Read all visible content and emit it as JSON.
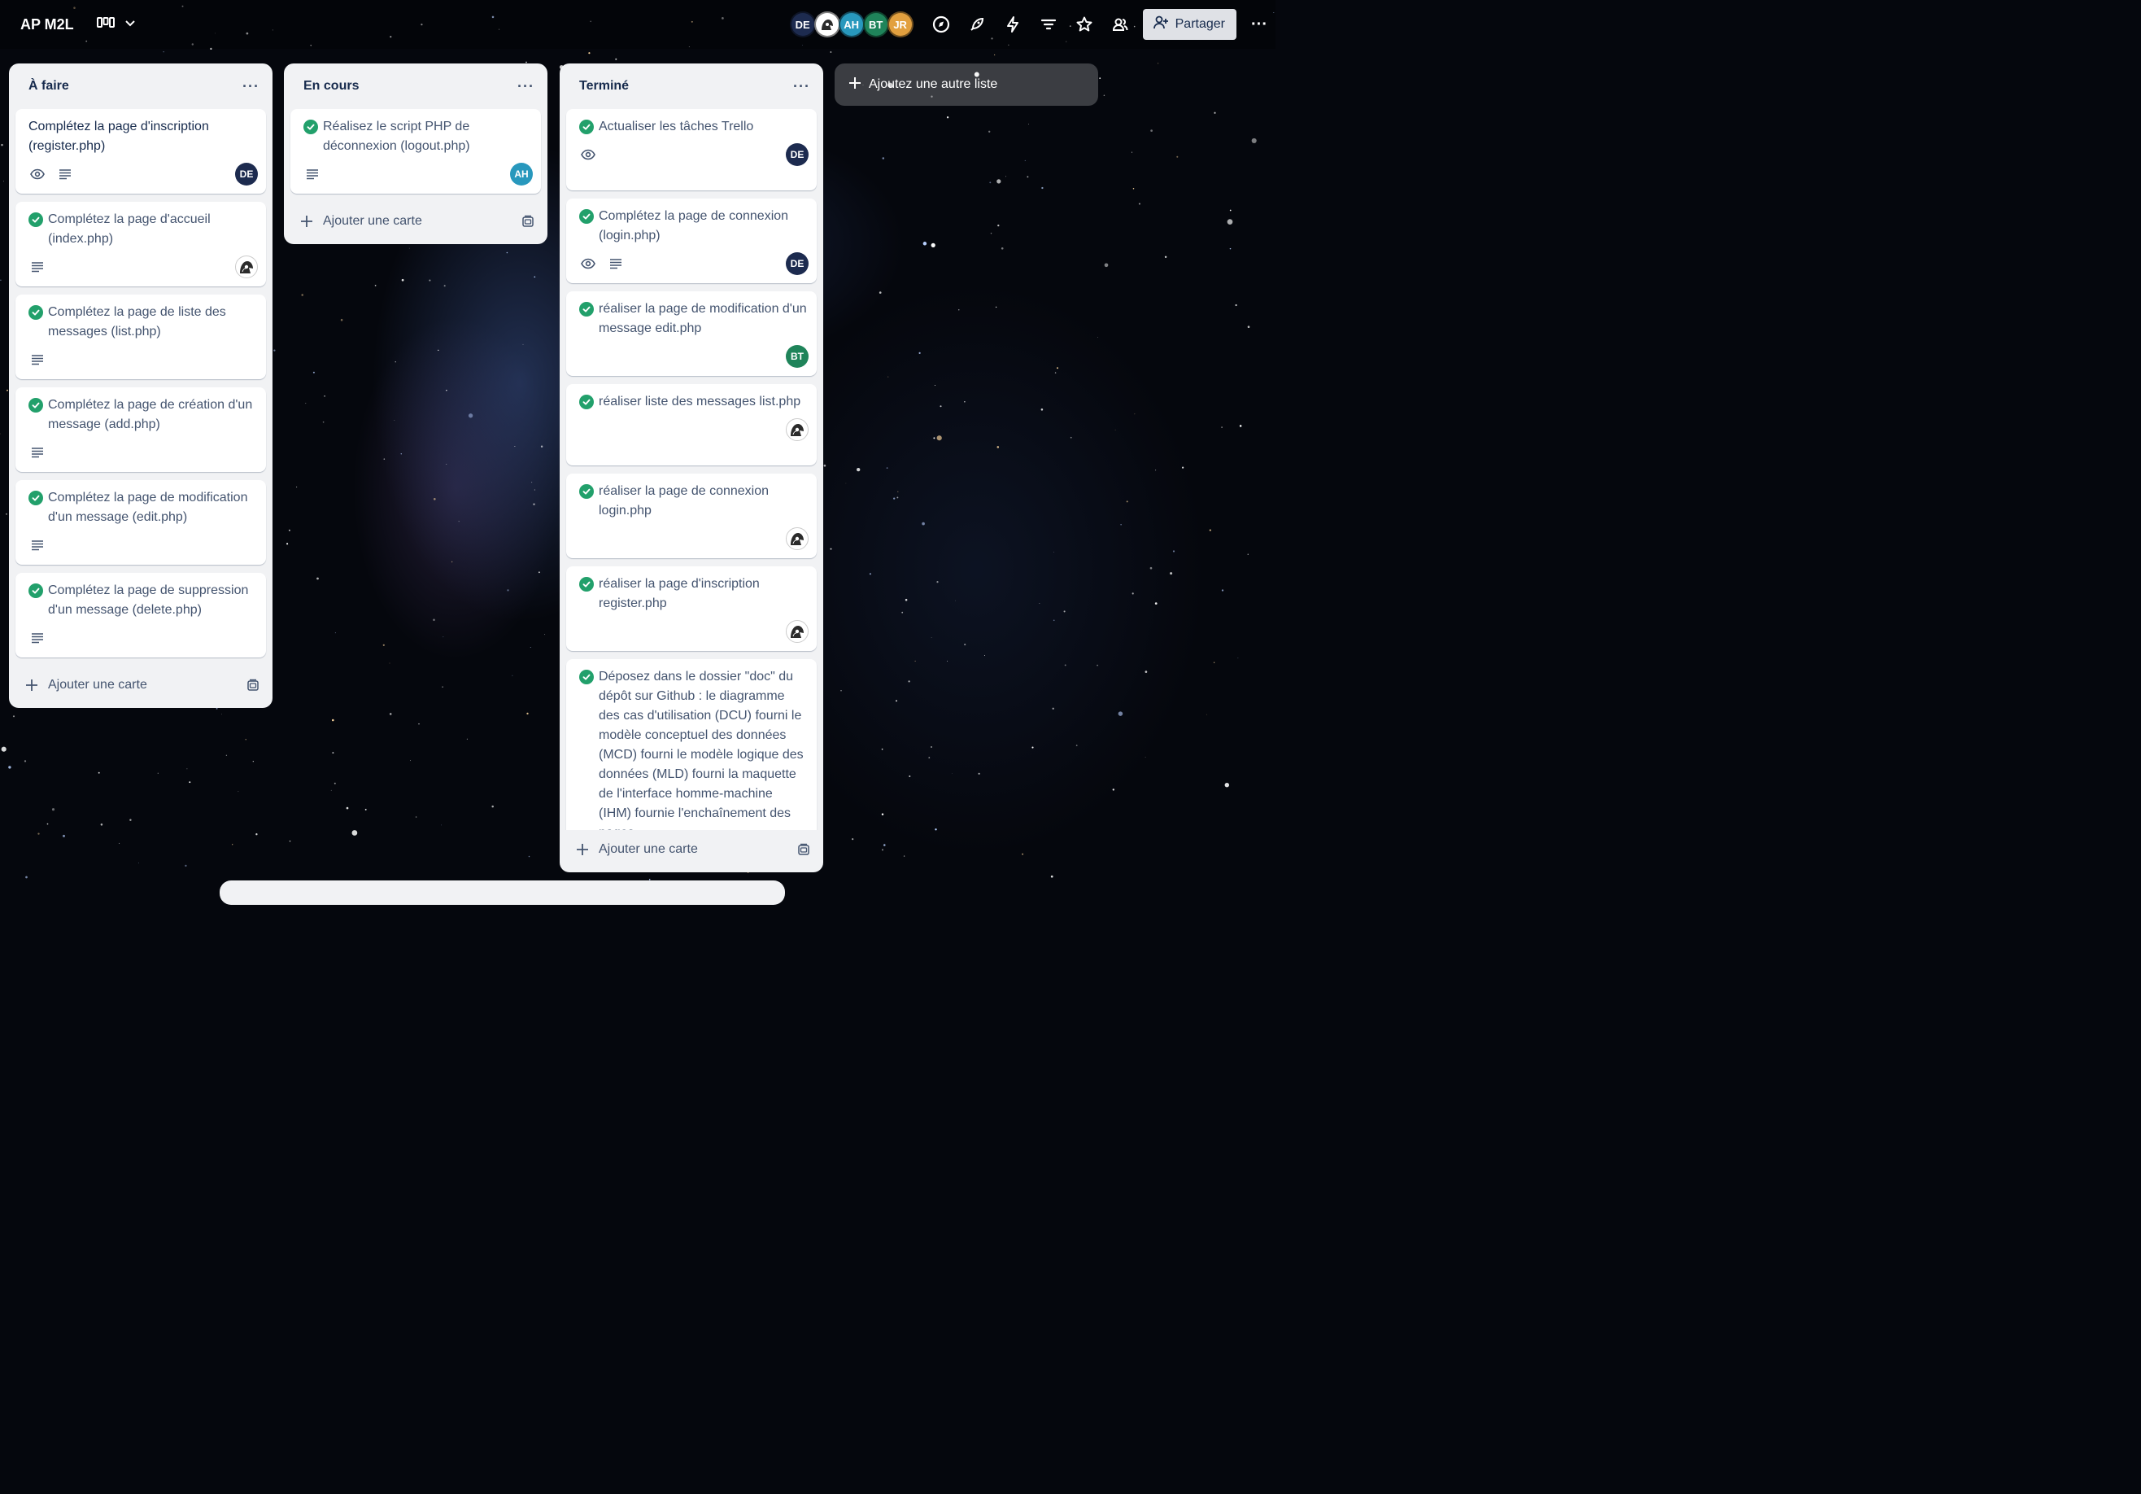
{
  "board": {
    "title": "AP M2L",
    "share_label": "Partager",
    "add_list_label": "Ajoutez une autre liste",
    "members": [
      {
        "initials": "DE",
        "color": "#1d2b4f"
      },
      {
        "initials": "",
        "color": "#ffffff"
      },
      {
        "initials": "AH",
        "color": "#2898bd"
      },
      {
        "initials": "BT",
        "color": "#1f845a"
      },
      {
        "initials": "JR",
        "color": "#e2a03f"
      }
    ]
  },
  "lists": [
    {
      "title": "À faire",
      "add_card_label": "Ajouter une carte",
      "cards": [
        {
          "title": "Complétez la page d'inscription (register.php)",
          "done": false,
          "watch": true,
          "desc": true,
          "member": "DE"
        },
        {
          "title": "Complétez la page d'accueil (index.php)",
          "done": true,
          "watch": false,
          "desc": true,
          "member": "IMG"
        },
        {
          "title": "Complétez la page de liste des messages (list.php)",
          "done": true,
          "watch": false,
          "desc": true,
          "member": ""
        },
        {
          "title": "Complétez la page de création d'un message (add.php)",
          "done": true,
          "watch": false,
          "desc": true,
          "member": ""
        },
        {
          "title": "Complétez la page de modification d'un message (edit.php)",
          "done": true,
          "watch": false,
          "desc": true,
          "member": ""
        },
        {
          "title": "Complétez la page de suppression d'un message (delete.php)",
          "done": true,
          "watch": false,
          "desc": true,
          "member": ""
        }
      ]
    },
    {
      "title": "En cours",
      "add_card_label": "Ajouter une carte",
      "cards": [
        {
          "title": "Réalisez le script PHP de déconnexion (logout.php)",
          "done": true,
          "watch": false,
          "desc": true,
          "member": "AH"
        }
      ]
    },
    {
      "title": "Terminé",
      "add_card_label": "Ajouter une carte",
      "cards": [
        {
          "title": "Actualiser les tâches Trello",
          "done": true,
          "watch": true,
          "desc": false,
          "member": "DE"
        },
        {
          "title": "Complétez la page de connexion (login.php)",
          "done": true,
          "watch": true,
          "desc": true,
          "member": "DE"
        },
        {
          "title": "réaliser la page de modification d'un message edit.php",
          "done": true,
          "watch": false,
          "desc": false,
          "member": "BT"
        },
        {
          "title": "réaliser liste des messages list.php",
          "done": true,
          "watch": false,
          "desc": false,
          "member": "IMG"
        },
        {
          "title": "réaliser la page de connexion login.php",
          "done": true,
          "watch": false,
          "desc": false,
          "member": "IMG"
        },
        {
          "title": "réaliser la page d'inscription register.php",
          "done": true,
          "watch": false,
          "desc": false,
          "member": "IMG"
        },
        {
          "title": "Déposez dans le dossier \"doc\" du dépôt sur Github : le diagramme des cas d'utilisation (DCU) fourni le modèle conceptuel des données (MCD) fourni le modèle logique des données (MLD) fourni la maquette de l'interface homme-machine (IHM) fournie l'enchaînement des pages",
          "done": true,
          "watch": false,
          "desc": false,
          "member": ""
        }
      ]
    }
  ],
  "colors": {
    "DE": "#1d2b4f",
    "AH": "#2898bd",
    "BT": "#1f845a",
    "check": "#22a06b"
  }
}
